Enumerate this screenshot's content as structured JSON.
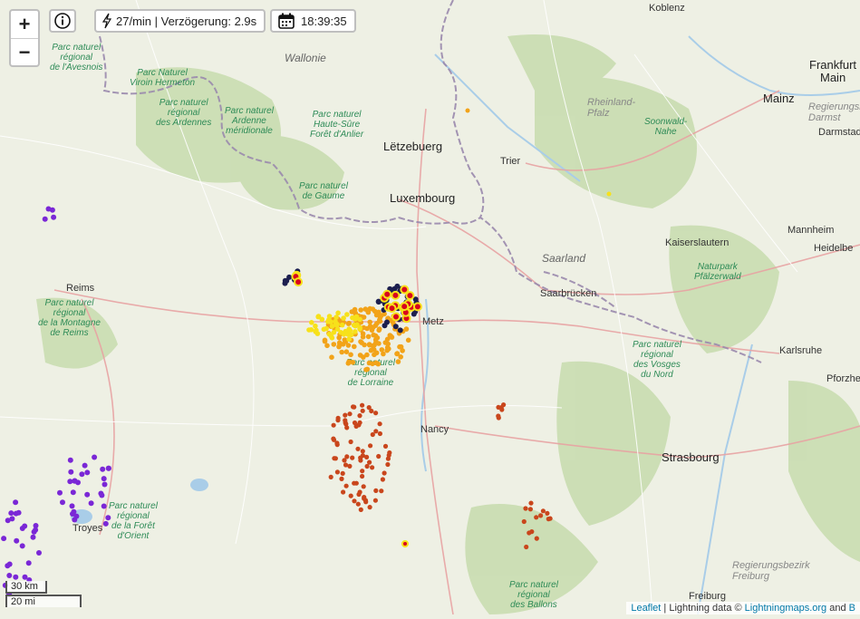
{
  "controls": {
    "zoom_in": "+",
    "zoom_out": "−",
    "info_icon": "info-icon",
    "rate_text": "27/min | Verzögerung: 2.9s",
    "time_text": "18:39:35"
  },
  "scale": {
    "km": "30 km",
    "mi": "20 mi"
  },
  "attribution": {
    "leaflet": "Leaflet",
    "sep": " | Lightning data © ",
    "source": "Lightningmaps.org",
    "and": " and ",
    "more": "B"
  },
  "colors": {
    "water": "#a9cde8",
    "forest": "#c9ddb0",
    "border": "#9a89ad",
    "road": "#e8a3a3",
    "strike_newest": "#d8041e",
    "strike_new": "#f7e11a",
    "strike_mid": "#f2a319",
    "strike_old": "#c9461c",
    "strike_oldest": "#7a27d6",
    "strike_dark": "#1c1f4f"
  },
  "labels": {
    "cities": [
      {
        "name": "Koblenz"
      },
      {
        "name": "Frankfurt"
      },
      {
        "name": "Main"
      },
      {
        "name": "Mainz"
      },
      {
        "name": "Darmstadt"
      },
      {
        "name": "Trier"
      },
      {
        "name": "Kaiserslautern"
      },
      {
        "name": "Mannheim"
      },
      {
        "name": "Heidelbe"
      },
      {
        "name": "Saarbrücken"
      },
      {
        "name": "Reims"
      },
      {
        "name": "Metz"
      },
      {
        "name": "Nancy"
      },
      {
        "name": "Karlsruhe"
      },
      {
        "name": "Pforzheim"
      },
      {
        "name": "Strasbourg"
      },
      {
        "name": "Troyes"
      },
      {
        "name": "Freiburg"
      },
      {
        "name": "Luxembourg"
      }
    ],
    "big": [
      {
        "name": "Lëtzebuerg"
      }
    ],
    "countries": [
      {
        "name": "Wallonie"
      },
      {
        "name": "Saarland"
      }
    ],
    "regions": [
      {
        "name": "Rheinland-\nPfalz"
      },
      {
        "name": "Regierungsbe\nDarmst"
      },
      {
        "name": "Regierungsbezirk\nFreiburg"
      }
    ],
    "parks": [
      {
        "name": "Parc naturel\nrégional\nde l'Avesnois"
      },
      {
        "name": "Parc Naturel\nViroin Hermeton"
      },
      {
        "name": "Parc naturel\nrégional\ndes Ardennes"
      },
      {
        "name": "Parc naturel\nArdenne\nméridionale"
      },
      {
        "name": "Parc naturel\nHaute-Sûre\nForêt d'Anlier"
      },
      {
        "name": "Parc naturel\nde Gaume"
      },
      {
        "name": "Soonwald-\nNahe"
      },
      {
        "name": "Naturpark\nPfälzerwald"
      },
      {
        "name": "Parc naturel\nrégional\nde la Montagne\nde Reims"
      },
      {
        "name": "Parc naturel\nrégional\nde Lorraine"
      },
      {
        "name": "Parc naturel\nrégional\ndes Vosges\ndu Nord"
      },
      {
        "name": "Parc naturel\nrégional\nde la Forêt\nd'Orient"
      },
      {
        "name": "Parc naturel\nrégional\ndes Ballons"
      }
    ]
  }
}
